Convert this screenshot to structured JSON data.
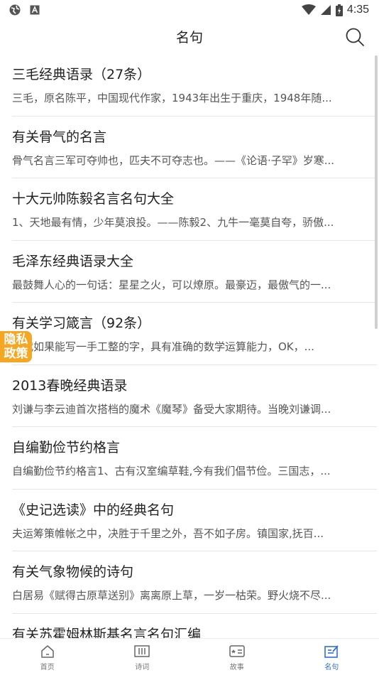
{
  "status_bar": {
    "time": "4:35"
  },
  "header": {
    "title": "名句"
  },
  "items": [
    {
      "title": "三毛经典语录（27条）",
      "desc": "三毛，原名陈平，中国现代作家，1943年出生于重庆，1948年随..."
    },
    {
      "title": "有关骨气的名言",
      "desc": "骨气名言三军可夺帅也，匹夫不可夺志也。——《论语·子罕》岁寒..."
    },
    {
      "title": "十大元帅陈毅名言名句大全",
      "desc": "1、天地最有情，少年莫浪投。——陈毅2、九牛一毫莫自夸，骄傲..."
    },
    {
      "title": "毛泽东经典语录大全",
      "desc": "最鼓舞人心的一句话：星星之火，可以燎原。最豪迈，最傲气的一..."
    },
    {
      "title": "有关学习箴言（92条）",
      "desc": "时代如果能写一手工整的字，具有准确的数学运算能力，OK，..."
    },
    {
      "title": "2013春晚经典语录",
      "desc": "刘谦与李云迪首次搭档的魔术《魔琴》备受大家期待。当晚刘谦调..."
    },
    {
      "title": "自编勤俭节约格言",
      "desc": "自编勤俭节约格言1、古有汉室编草鞋,今有我们倡节俭。三国志，..."
    },
    {
      "title": "《史记选读》中的经典名句",
      "desc": "夫运筹策帷帐之中，决胜于千里之外，吾不如子房。镇国家,抚百..."
    },
    {
      "title": "有关气象物候的诗句",
      "desc": "白居易《赋得古原草送别》离离原上草，一岁一枯荣。野火烧不尽..."
    },
    {
      "title": "有关苏霍姆林斯基名言名句汇编",
      "desc": ""
    }
  ],
  "privacy_badge": {
    "line1": "隐私",
    "line2": "政策"
  },
  "bottom_nav": [
    {
      "label": "首页",
      "icon": "home-icon"
    },
    {
      "label": "诗词",
      "icon": "poetry-icon"
    },
    {
      "label": "故事",
      "icon": "story-icon"
    },
    {
      "label": "名句",
      "icon": "quote-icon"
    }
  ],
  "colors": {
    "accent": "#2f6fd6",
    "badge": "#f5a623"
  }
}
